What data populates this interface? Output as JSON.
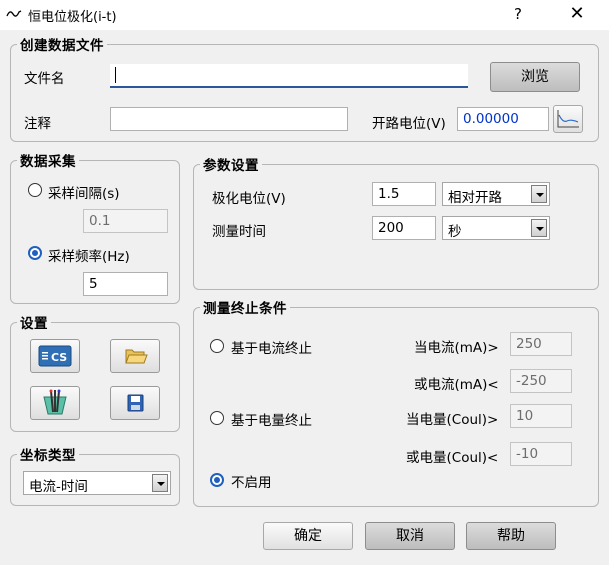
{
  "window": {
    "title": "恒电位极化(i-t)",
    "help_glyph": "?",
    "close_glyph": "✕"
  },
  "create_file": {
    "title": "创建数据文件",
    "filename_label": "文件名",
    "filename_value": "",
    "browse_label": "浏览",
    "note_label": "注释",
    "note_value": "",
    "ocp_label": "开路电位(V)",
    "ocp_value": "0.00000"
  },
  "sampling": {
    "title": "数据采集",
    "interval_label": "采样间隔(s)",
    "interval_value": "0.1",
    "interval_checked": false,
    "freq_label": "采样频率(Hz)",
    "freq_value": "5",
    "freq_checked": true
  },
  "params": {
    "title": "参数设置",
    "potential_label": "极化电位(V)",
    "potential_value": "1.5",
    "potential_ref": "相对开路",
    "time_label": "测量时间",
    "time_value": "200",
    "time_unit": "秒"
  },
  "settings": {
    "title": "设置",
    "cs_icon_text": "CS"
  },
  "coord": {
    "title": "坐标类型",
    "value": "电流-时间"
  },
  "stop": {
    "title": "测量终止条件",
    "current_label": "基于电流终止",
    "current_checked": false,
    "charge_label": "基于电量终止",
    "charge_checked": false,
    "disabled_label": "不启用",
    "disabled_checked": true,
    "i_high_label": "当电流(mA)>",
    "i_high_value": "250",
    "i_low_label": "或电流(mA)<",
    "i_low_value": "-250",
    "q_high_label": "当电量(Coul)>",
    "q_high_value": "10",
    "q_low_label": "或电量(Coul)<",
    "q_low_value": "-10"
  },
  "footer": {
    "ok_label": "确定",
    "cancel_label": "取消",
    "help_label": "帮助"
  }
}
